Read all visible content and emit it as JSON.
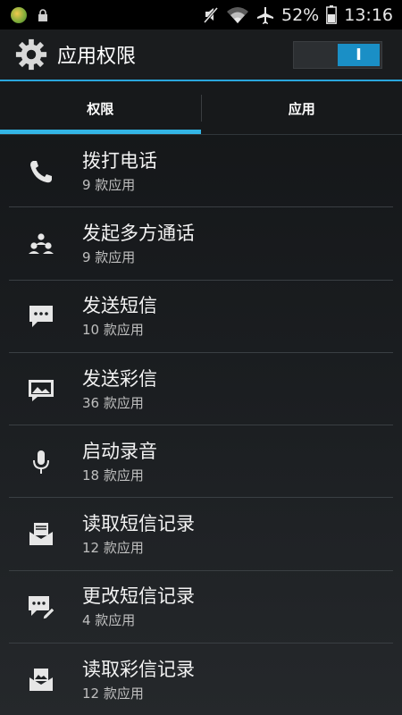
{
  "status_bar": {
    "battery": "52%",
    "time": "13:16",
    "icons": [
      "app-notification-icon",
      "lock-icon",
      "mute-icon",
      "wifi-icon",
      "airplane-icon",
      "battery-icon"
    ]
  },
  "action_bar": {
    "title": "应用权限",
    "toggle_label": "I"
  },
  "tabs": [
    {
      "label": "权限",
      "selected": true
    },
    {
      "label": "应用",
      "selected": false
    }
  ],
  "permissions": [
    {
      "name": "拨打电话",
      "count": "9 款应用",
      "icon": "phone-icon"
    },
    {
      "name": "发起多方通话",
      "count": "9 款应用",
      "icon": "conference-call-icon"
    },
    {
      "name": "发送短信",
      "count": "10 款应用",
      "icon": "sms-icon"
    },
    {
      "name": "发送彩信",
      "count": "36 款应用",
      "icon": "mms-icon"
    },
    {
      "name": "启动录音",
      "count": "18 款应用",
      "icon": "microphone-icon"
    },
    {
      "name": "读取短信记录",
      "count": "12 款应用",
      "icon": "read-sms-icon"
    },
    {
      "name": "更改短信记录",
      "count": "4 款应用",
      "icon": "edit-sms-icon"
    },
    {
      "name": "读取彩信记录",
      "count": "12 款应用",
      "icon": "read-mms-icon"
    }
  ],
  "colors": {
    "accent": "#33b5e5",
    "toggle_on": "#1a8fc6"
  }
}
